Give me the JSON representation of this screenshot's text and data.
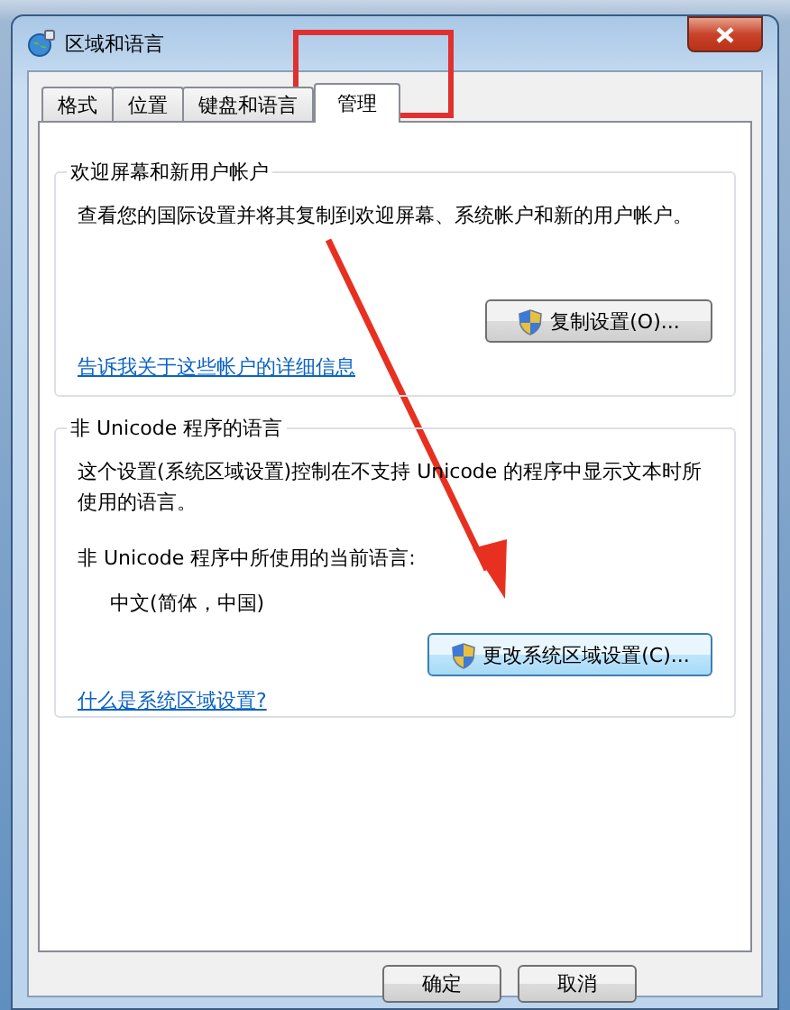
{
  "window": {
    "title": "区域和语言"
  },
  "tabs": [
    {
      "label": "格式",
      "selected": false
    },
    {
      "label": "位置",
      "selected": false
    },
    {
      "label": "键盘和语言",
      "selected": false
    },
    {
      "label": "管理",
      "selected": true
    }
  ],
  "groups": [
    {
      "title": "欢迎屏幕和新用户帐户",
      "items": [
        {
          "kind": "text",
          "text": "查看您的国际设置并将其复制到欢迎屏幕、系统帐户和新的用户帐户。"
        },
        {
          "kind": "button",
          "label": "复制设置(O)...",
          "shield": true
        },
        {
          "kind": "link",
          "text": "告诉我关于这些帐户的详细信息"
        }
      ]
    },
    {
      "title": "非 Unicode 程序的语言",
      "items": [
        {
          "kind": "text",
          "text": "这个设置(系统区域设置)控制在不支持 Unicode 的程序中显示文本时所使用的语言。"
        },
        {
          "kind": "label",
          "text": "非 Unicode 程序中所使用的当前语言:"
        },
        {
          "kind": "value",
          "text": "中文(简体，中国)"
        },
        {
          "kind": "button",
          "label": "更改系统区域设置(C)...",
          "shield": true,
          "hovered": true
        },
        {
          "kind": "link",
          "text": "什么是系统区域设置?"
        }
      ]
    }
  ],
  "buttons": [
    "确定",
    "取消"
  ]
}
